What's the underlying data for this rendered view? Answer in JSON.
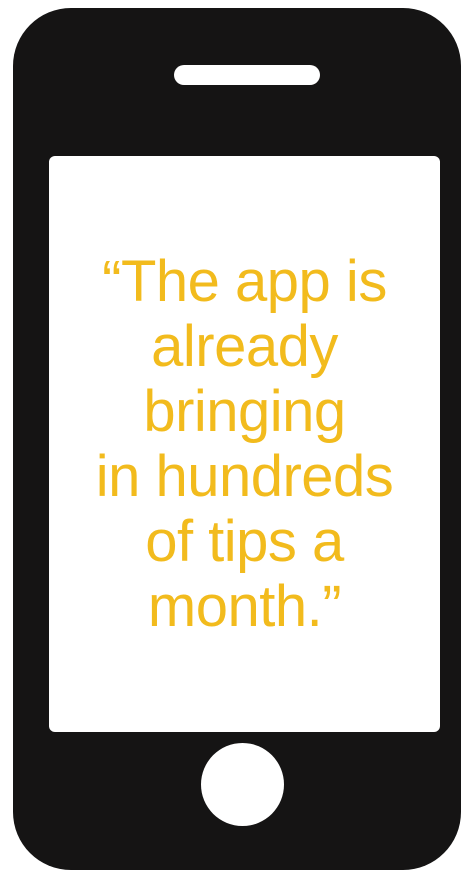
{
  "phone": {
    "screen_quote": "“The app is\nalready\nbringing\nin hundreds\nof tips a\nmonth.”",
    "colors": {
      "body": "#151414",
      "screen": "#ffffff",
      "quote_text": "#f2bb1d"
    },
    "icons": {
      "speaker": "speaker-slot",
      "home_button": "home-button"
    }
  }
}
